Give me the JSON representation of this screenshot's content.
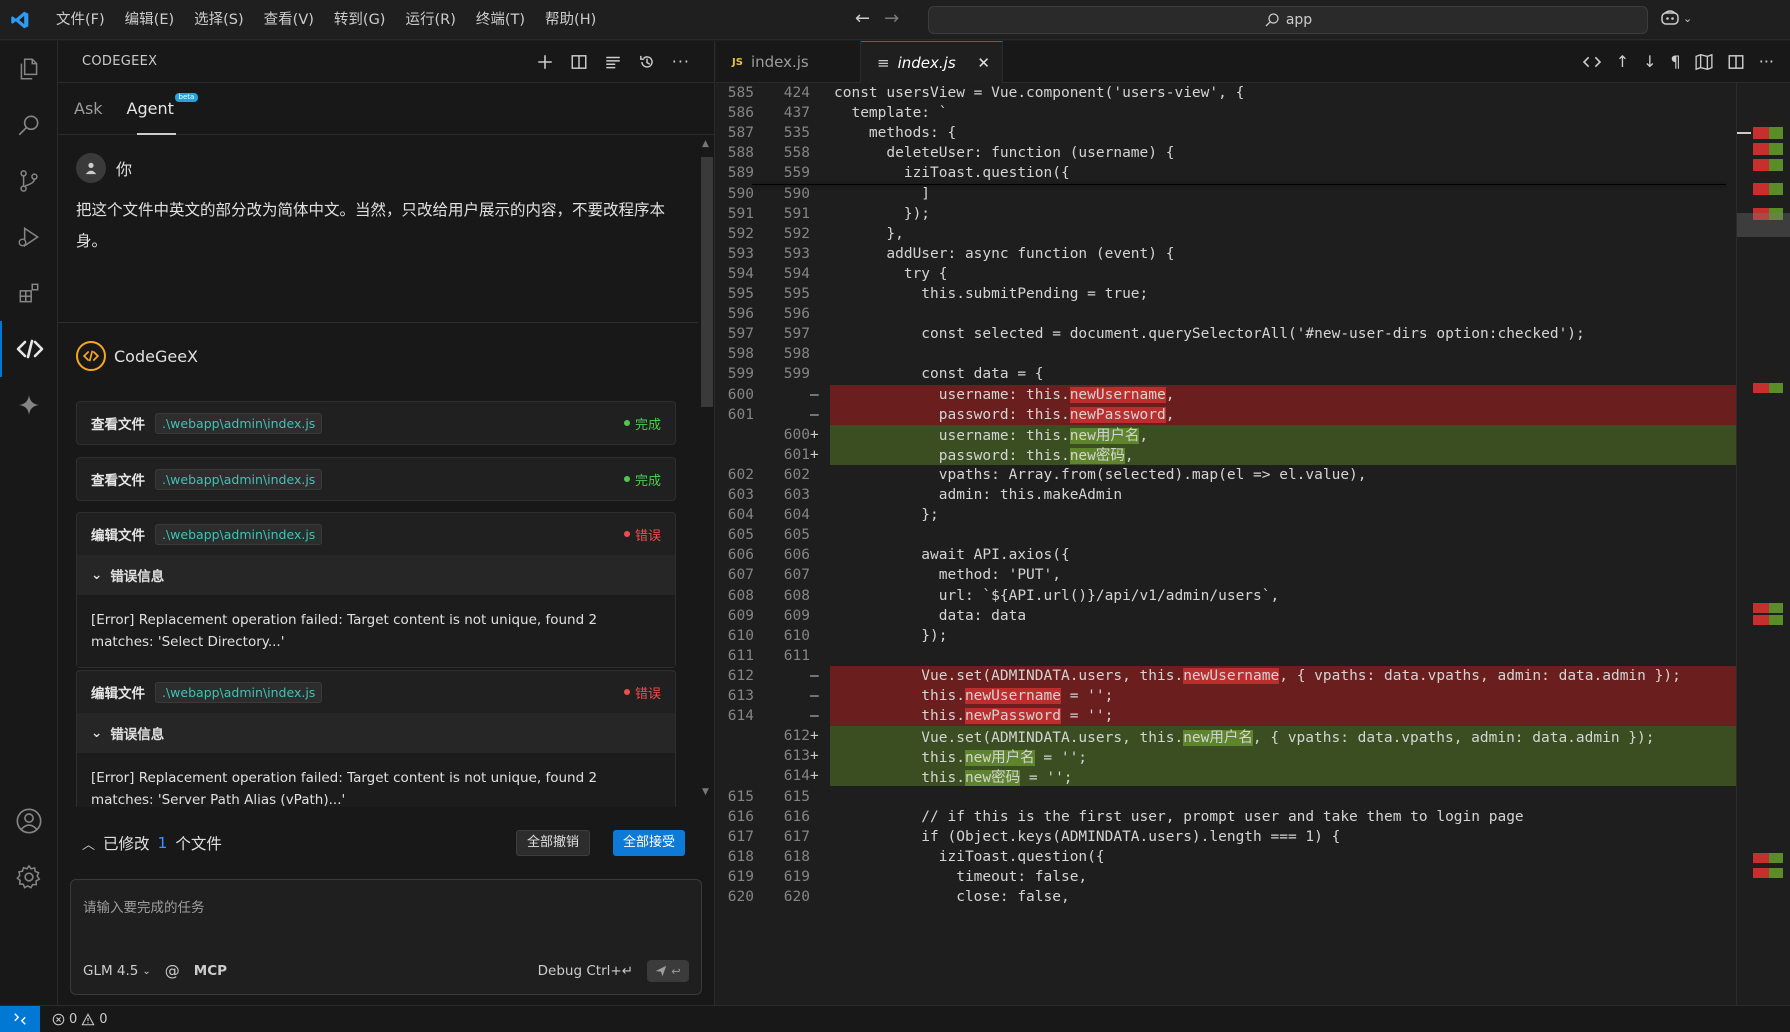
{
  "menu": [
    "文件(F)",
    "编辑(E)",
    "选择(S)",
    "查看(V)",
    "转到(G)",
    "运行(R)",
    "终端(T)",
    "帮助(H)"
  ],
  "search": {
    "text": "app"
  },
  "panel": {
    "title": "CODEGEEX",
    "tabs": {
      "ask": "Ask",
      "agent": "Agent",
      "beta": "beta"
    },
    "user": {
      "name": "你",
      "message": "把这个文件中英文的部分改为简体中文。当然，只改给用户展示的内容，不要改程序本身。"
    },
    "bot": {
      "name": "CodeGeeX"
    },
    "cards": [
      {
        "label": "查看文件",
        "path": ".\\webapp\\admin\\index.js",
        "status": "完成"
      },
      {
        "label": "查看文件",
        "path": ".\\webapp\\admin\\index.js",
        "status": "完成"
      },
      {
        "label": "编辑文件",
        "path": ".\\webapp\\admin\\index.js",
        "status": "错误",
        "toggle": "错误信息",
        "error": "[Error] Replacement operation failed: Target content is not unique, found 2 matches: 'Select Directory...'"
      },
      {
        "label": "编辑文件",
        "path": ".\\webapp\\admin\\index.js",
        "status": "错误",
        "toggle": "错误信息",
        "error": "[Error] Replacement operation failed: Target content is not unique, found 2 matches: 'Server Path Alias (vPath)...'"
      }
    ],
    "modified": {
      "prefix": "已修改",
      "count": "1",
      "suffix": "个文件",
      "undo": "全部撤销",
      "accept": "全部接受"
    },
    "input": {
      "placeholder": "请输入要完成的任务",
      "model": "GLM 4.5",
      "at": "@",
      "mcp": "MCP",
      "debug": "Debug Ctrl+↵"
    }
  },
  "editor": {
    "tabs": [
      {
        "label": "index.js",
        "badge": "JS"
      },
      {
        "label": "index.js"
      }
    ],
    "lines": [
      {
        "o": "585",
        "n": "424",
        "m": "",
        "t": "const usersView = Vue.component('users-view', {",
        "k": "n"
      },
      {
        "o": "586",
        "n": "437",
        "m": "",
        "t": "  template: `",
        "k": "n"
      },
      {
        "o": "587",
        "n": "535",
        "m": "",
        "t": "    methods: {",
        "k": "n"
      },
      {
        "o": "588",
        "n": "558",
        "m": "",
        "t": "      deleteUser: function (username) {",
        "k": "n"
      },
      {
        "o": "589",
        "n": "559",
        "m": "",
        "t": "        iziToast.question({",
        "k": "n"
      },
      {
        "o": "590",
        "n": "590",
        "m": "",
        "t": "          ]",
        "k": "n"
      },
      {
        "o": "591",
        "n": "591",
        "m": "",
        "t": "        });",
        "k": "n"
      },
      {
        "o": "592",
        "n": "592",
        "m": "",
        "t": "      },",
        "k": "n"
      },
      {
        "o": "593",
        "n": "593",
        "m": "",
        "t": "      addUser: async function (event) {",
        "k": "n"
      },
      {
        "o": "594",
        "n": "594",
        "m": "",
        "t": "        try {",
        "k": "n"
      },
      {
        "o": "595",
        "n": "595",
        "m": "",
        "t": "          this.submitPending = true;",
        "k": "n"
      },
      {
        "o": "596",
        "n": "596",
        "m": "",
        "t": "",
        "k": "n"
      },
      {
        "o": "597",
        "n": "597",
        "m": "",
        "t": "          const selected = document.querySelectorAll('#new-user-dirs option:checked');",
        "k": "n"
      },
      {
        "o": "598",
        "n": "598",
        "m": "",
        "t": "",
        "k": "n"
      },
      {
        "o": "599",
        "n": "599",
        "m": "",
        "t": "          const data = {",
        "k": "n"
      },
      {
        "o": "600",
        "n": "",
        "m": "—",
        "t": "            username: this.newUsername,",
        "k": "d"
      },
      {
        "o": "601",
        "n": "",
        "m": "—",
        "t": "            password: this.newPassword,",
        "k": "d"
      },
      {
        "o": "",
        "n": "600",
        "m": "+",
        "t": "            username: this.new用户名,",
        "k": "a"
      },
      {
        "o": "",
        "n": "601",
        "m": "+",
        "t": "            password: this.new密码,",
        "k": "a"
      },
      {
        "o": "602",
        "n": "602",
        "m": "",
        "t": "            vpaths: Array.from(selected).map(el => el.value),",
        "k": "n"
      },
      {
        "o": "603",
        "n": "603",
        "m": "",
        "t": "            admin: this.makeAdmin",
        "k": "n"
      },
      {
        "o": "604",
        "n": "604",
        "m": "",
        "t": "          };",
        "k": "n"
      },
      {
        "o": "605",
        "n": "605",
        "m": "",
        "t": "",
        "k": "n"
      },
      {
        "o": "606",
        "n": "606",
        "m": "",
        "t": "          await API.axios({",
        "k": "n"
      },
      {
        "o": "607",
        "n": "607",
        "m": "",
        "t": "            method: 'PUT',",
        "k": "n"
      },
      {
        "o": "608",
        "n": "608",
        "m": "",
        "t": "            url: `${API.url()}/api/v1/admin/users`,",
        "k": "n"
      },
      {
        "o": "609",
        "n": "609",
        "m": "",
        "t": "            data: data",
        "k": "n"
      },
      {
        "o": "610",
        "n": "610",
        "m": "",
        "t": "          });",
        "k": "n"
      },
      {
        "o": "611",
        "n": "611",
        "m": "",
        "t": "",
        "k": "n"
      },
      {
        "o": "612",
        "n": "",
        "m": "—",
        "t": "          Vue.set(ADMINDATA.users, this.newUsername, { vpaths: data.vpaths, admin: data.admin });",
        "k": "d"
      },
      {
        "o": "613",
        "n": "",
        "m": "—",
        "t": "          this.newUsername = '';",
        "k": "d"
      },
      {
        "o": "614",
        "n": "",
        "m": "—",
        "t": "          this.newPassword = '';",
        "k": "d"
      },
      {
        "o": "",
        "n": "612",
        "m": "+",
        "t": "          Vue.set(ADMINDATA.users, this.new用户名, { vpaths: data.vpaths, admin: data.admin });",
        "k": "a"
      },
      {
        "o": "",
        "n": "613",
        "m": "+",
        "t": "          this.new用户名 = '';",
        "k": "a"
      },
      {
        "o": "",
        "n": "614",
        "m": "+",
        "t": "          this.new密码 = '';",
        "k": "a"
      },
      {
        "o": "615",
        "n": "615",
        "m": "",
        "t": "",
        "k": "n"
      },
      {
        "o": "616",
        "n": "616",
        "m": "",
        "t": "          // if this is the first user, prompt user and take them to login page",
        "k": "n"
      },
      {
        "o": "617",
        "n": "617",
        "m": "",
        "t": "          if (Object.keys(ADMINDATA.users).length === 1) {",
        "k": "n"
      },
      {
        "o": "618",
        "n": "618",
        "m": "",
        "t": "            iziToast.question({",
        "k": "n"
      },
      {
        "o": "619",
        "n": "619",
        "m": "",
        "t": "              timeout: false,",
        "k": "n"
      },
      {
        "o": "620",
        "n": "620",
        "m": "",
        "t": "              close: false,",
        "k": "n"
      }
    ]
  },
  "statusbar": {
    "errors": "0",
    "warnings": "0"
  },
  "colors": {
    "accent": "#0078d4",
    "ok": "#4ec94e",
    "err": "#f14c4c",
    "path": "#3dc3b6"
  }
}
